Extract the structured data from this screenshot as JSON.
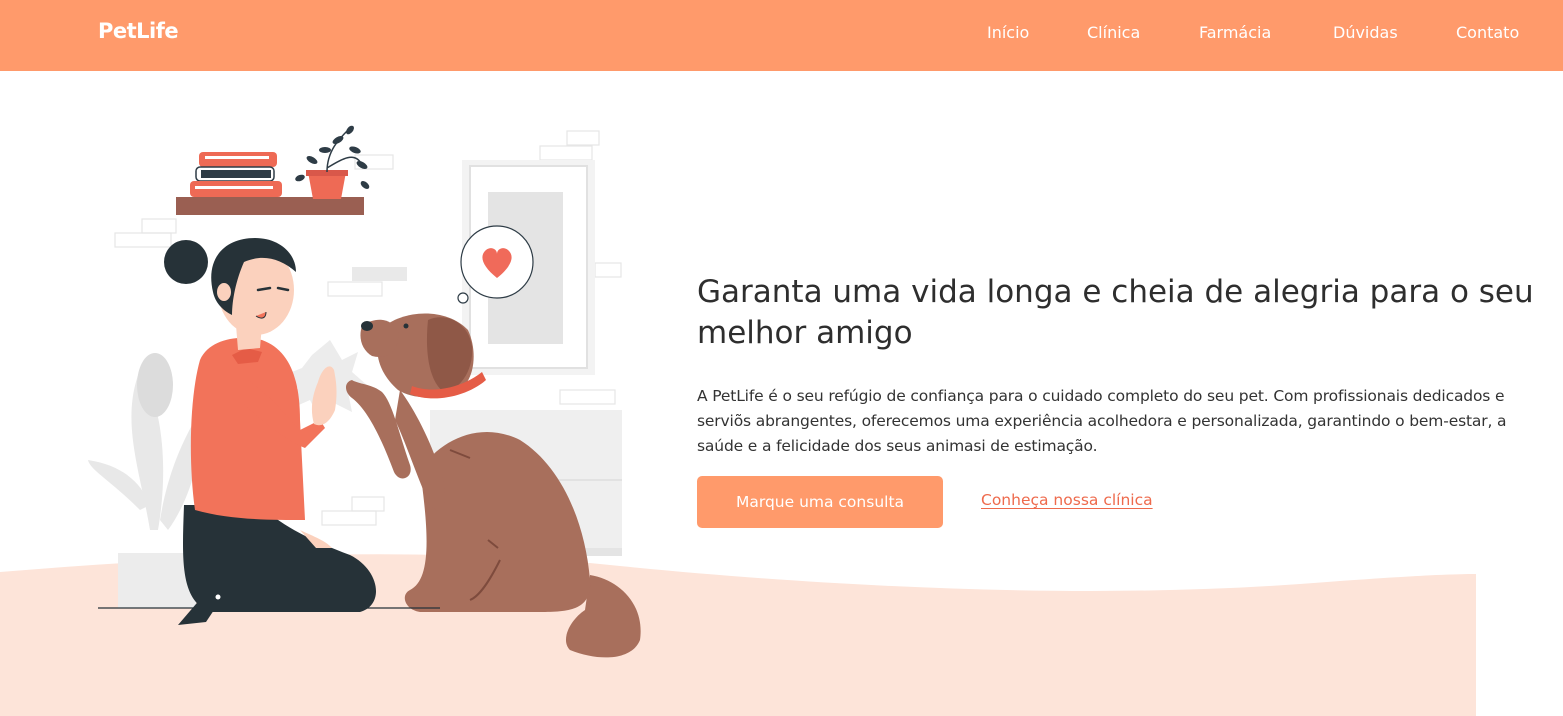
{
  "brand": {
    "name": "PetLife"
  },
  "nav": {
    "items": [
      {
        "label": "Início"
      },
      {
        "label": "Clínica"
      },
      {
        "label": "Farmácia"
      },
      {
        "label": "Dúvidas"
      },
      {
        "label": "Contato"
      }
    ]
  },
  "hero": {
    "title": "Garanta uma vida longa e cheia de alegria para o seu melhor amigo",
    "description": "A PetLife é o seu refúgio de confiança para o cuidado completo do seu pet. Com profissionais dedicados e serviõs abrangentes, oferecemos uma experiência acolhedora e personalizada, garantindo o bem-estar, a saúde e a felicidade dos seus animasi de estimação.",
    "primary_button": "Marque uma consulta",
    "secondary_link": "Conheça nossa clínica"
  },
  "colors": {
    "brand_orange": "#ff9a6b",
    "link_coral": "#ee6a4c",
    "ground_peach": "#fde4d9",
    "dog_brown": "#a86f5c",
    "shirt_coral": "#f2735a"
  }
}
